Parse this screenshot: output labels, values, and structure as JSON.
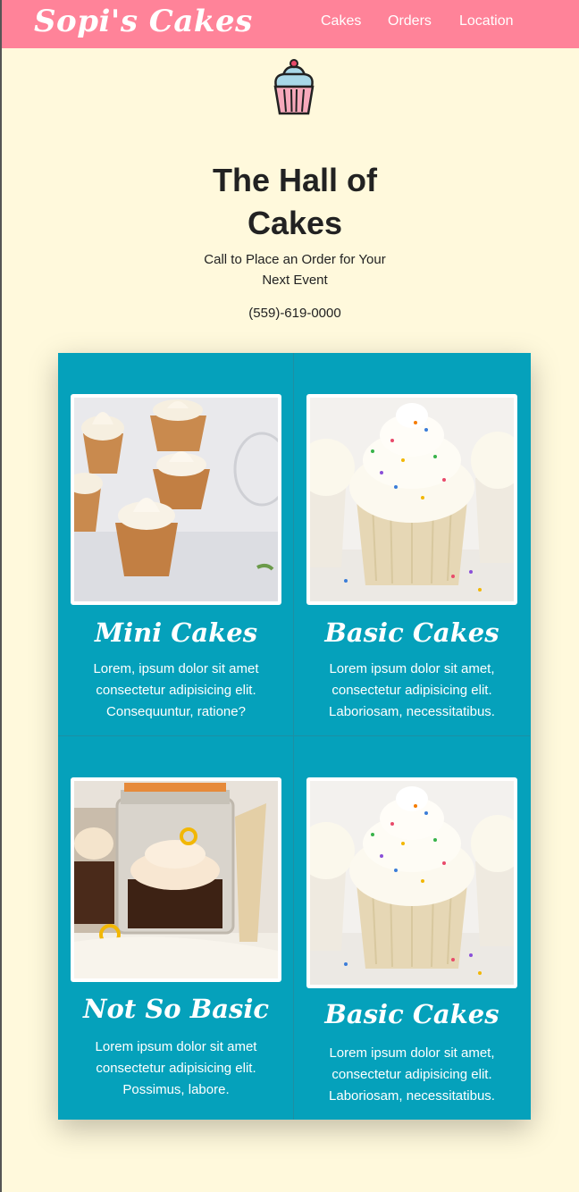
{
  "nav": {
    "brand": "Sopi's Cakes",
    "links": [
      "Cakes",
      "Orders",
      "Location"
    ]
  },
  "hero": {
    "icon": "cupcake-icon",
    "title_line1": "The Hall of",
    "title_line2": "Cakes",
    "subtitle_line1": "Call to Place an Order for Your",
    "subtitle_line2": "Next Event",
    "phone": "(559)-619-0000"
  },
  "cards": [
    {
      "title": "Mini Cakes",
      "image": "mini-cakes-photo",
      "lines": [
        "Lorem, ipsum dolor sit amet",
        "consectetur adipisicing elit.",
        "Consequuntur, ratione?"
      ]
    },
    {
      "title": "Basic Cakes",
      "image": "basic-cakes-photo",
      "lines": [
        "Lorem ipsum dolor sit amet,",
        "consectetur adipisicing elit.",
        "Laboriosam, necessitatibus."
      ]
    },
    {
      "title": "Not So Basic",
      "image": "jar-cake-photo",
      "lines": [
        "Lorem ipsum dolor sit amet",
        "consectetur adipisicing elit.",
        "Possimus, labore."
      ]
    },
    {
      "title": "Basic Cakes",
      "image": "basic-cakes-photo",
      "lines": [
        "Lorem ipsum dolor sit amet,",
        "consectetur adipisicing elit.",
        "Laboriosam, necessitatibus."
      ]
    }
  ],
  "colors": {
    "navbar": "#ff8399",
    "page_background": "#fff9dc",
    "card_background": "#05a1bb"
  }
}
